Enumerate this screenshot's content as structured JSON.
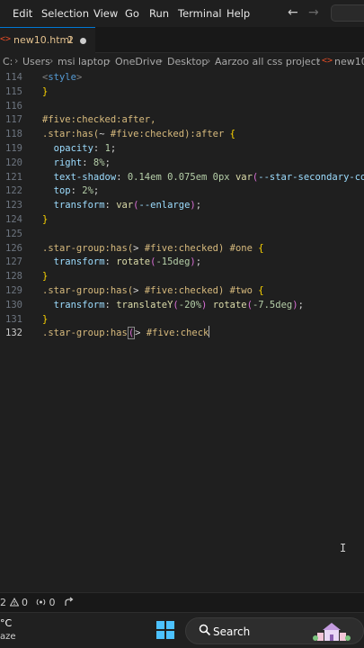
{
  "menu": [
    "Edit",
    "Selection",
    "View",
    "Go",
    "Run",
    "Terminal",
    "Help"
  ],
  "tab": {
    "icon": "html-file-icon",
    "label": "new10.html",
    "problems": "2"
  },
  "breadcrumb": [
    "C:",
    "Users",
    "msi laptop",
    "OneDrive",
    "Desktop",
    "Aarzoo all css project",
    "new10.ht"
  ],
  "status": {
    "errors": "2",
    "warnings": "0",
    "ports": "0"
  },
  "taskbar": {
    "temp": "°C",
    "weather": "aze",
    "search": "Search"
  },
  "colors": {
    "selector": "#d7ba7d",
    "property": "#9cdcfe",
    "number": "#b5cea8",
    "function": "#dcdcaa",
    "tag": "#569cd6",
    "accent": "#0078d4",
    "tab_text": "#e2c08d"
  },
  "editor": {
    "active_line": "132",
    "lines": [
      {
        "num": "115",
        "tokens": [
          {
            "t": "}",
            "c": "t-brace"
          }
        ]
      },
      {
        "num": "116",
        "tokens": []
      },
      {
        "num": "117",
        "tokens": [
          {
            "t": "#five:checked:after,",
            "c": "t-sel"
          }
        ]
      },
      {
        "num": "118",
        "tokens": [
          {
            "t": ".star:has(",
            "c": "t-sel"
          },
          {
            "t": "~ ",
            "c": "t-plain"
          },
          {
            "t": "#five:checked",
            "c": "t-sel"
          },
          {
            "t": "):after ",
            "c": "t-sel"
          },
          {
            "t": "{",
            "c": "t-brace"
          }
        ]
      },
      {
        "num": "119",
        "tokens": [
          {
            "t": "  opacity",
            "c": "t-prop"
          },
          {
            "t": ": ",
            "c": "t-plain"
          },
          {
            "t": "1",
            "c": "t-num"
          },
          {
            "t": ";",
            "c": "t-plain"
          }
        ]
      },
      {
        "num": "120",
        "tokens": [
          {
            "t": "  right",
            "c": "t-prop"
          },
          {
            "t": ": ",
            "c": "t-plain"
          },
          {
            "t": "8%",
            "c": "t-num"
          },
          {
            "t": ";",
            "c": "t-plain"
          }
        ]
      },
      {
        "num": "121",
        "tokens": [
          {
            "t": "  text-shadow",
            "c": "t-prop"
          },
          {
            "t": ": ",
            "c": "t-plain"
          },
          {
            "t": "0.14em 0.075em 0px ",
            "c": "t-num"
          },
          {
            "t": "var",
            "c": "t-fn"
          },
          {
            "t": "(",
            "c": "t-paren"
          },
          {
            "t": "--star-secondary-co",
            "c": "t-prop"
          }
        ]
      },
      {
        "num": "122",
        "tokens": [
          {
            "t": "  top",
            "c": "t-prop"
          },
          {
            "t": ": ",
            "c": "t-plain"
          },
          {
            "t": "2%",
            "c": "t-num"
          },
          {
            "t": ";",
            "c": "t-plain"
          }
        ]
      },
      {
        "num": "123",
        "tokens": [
          {
            "t": "  transform",
            "c": "t-prop"
          },
          {
            "t": ": ",
            "c": "t-plain"
          },
          {
            "t": "var",
            "c": "t-fn"
          },
          {
            "t": "(",
            "c": "t-paren"
          },
          {
            "t": "--enlarge",
            "c": "t-prop"
          },
          {
            "t": ")",
            "c": "t-paren"
          },
          {
            "t": ";",
            "c": "t-plain"
          }
        ]
      },
      {
        "num": "124",
        "tokens": [
          {
            "t": "}",
            "c": "t-brace"
          }
        ]
      },
      {
        "num": "125",
        "tokens": []
      },
      {
        "num": "126",
        "tokens": [
          {
            "t": ".star-group:has(",
            "c": "t-sel"
          },
          {
            "t": "> ",
            "c": "t-plain"
          },
          {
            "t": "#five:checked",
            "c": "t-sel"
          },
          {
            "t": ") #one ",
            "c": "t-sel"
          },
          {
            "t": "{",
            "c": "t-brace"
          }
        ]
      },
      {
        "num": "127",
        "tokens": [
          {
            "t": "  transform",
            "c": "t-prop"
          },
          {
            "t": ": ",
            "c": "t-plain"
          },
          {
            "t": "rotate",
            "c": "t-fn"
          },
          {
            "t": "(",
            "c": "t-paren"
          },
          {
            "t": "-15deg",
            "c": "t-num"
          },
          {
            "t": ")",
            "c": "t-paren"
          },
          {
            "t": ";",
            "c": "t-plain"
          }
        ]
      },
      {
        "num": "128",
        "tokens": [
          {
            "t": "}",
            "c": "t-brace"
          }
        ]
      },
      {
        "num": "129",
        "tokens": [
          {
            "t": ".star-group:has(",
            "c": "t-sel"
          },
          {
            "t": "> ",
            "c": "t-plain"
          },
          {
            "t": "#five:checked",
            "c": "t-sel"
          },
          {
            "t": ") #two ",
            "c": "t-sel"
          },
          {
            "t": "{",
            "c": "t-brace"
          }
        ]
      },
      {
        "num": "130",
        "tokens": [
          {
            "t": "  transform",
            "c": "t-prop"
          },
          {
            "t": ": ",
            "c": "t-plain"
          },
          {
            "t": "translateY",
            "c": "t-fn"
          },
          {
            "t": "(",
            "c": "t-paren"
          },
          {
            "t": "-20%",
            "c": "t-num"
          },
          {
            "t": ") ",
            "c": "t-paren"
          },
          {
            "t": "rotate",
            "c": "t-fn"
          },
          {
            "t": "(",
            "c": "t-paren"
          },
          {
            "t": "-7.5deg",
            "c": "t-num"
          },
          {
            "t": ")",
            "c": "t-paren"
          },
          {
            "t": ";",
            "c": "t-plain"
          }
        ]
      },
      {
        "num": "131",
        "tokens": [
          {
            "t": "}",
            "c": "t-brace"
          }
        ]
      },
      {
        "num": "132",
        "tokens": [
          {
            "t": ".star-group:has",
            "c": "t-sel"
          },
          {
            "t": "(",
            "c": "t-paren paren-hl"
          },
          {
            "t": "> ",
            "c": "t-plain"
          },
          {
            "t": "#five:check",
            "c": "t-sel"
          }
        ],
        "cursor": true
      }
    ]
  }
}
